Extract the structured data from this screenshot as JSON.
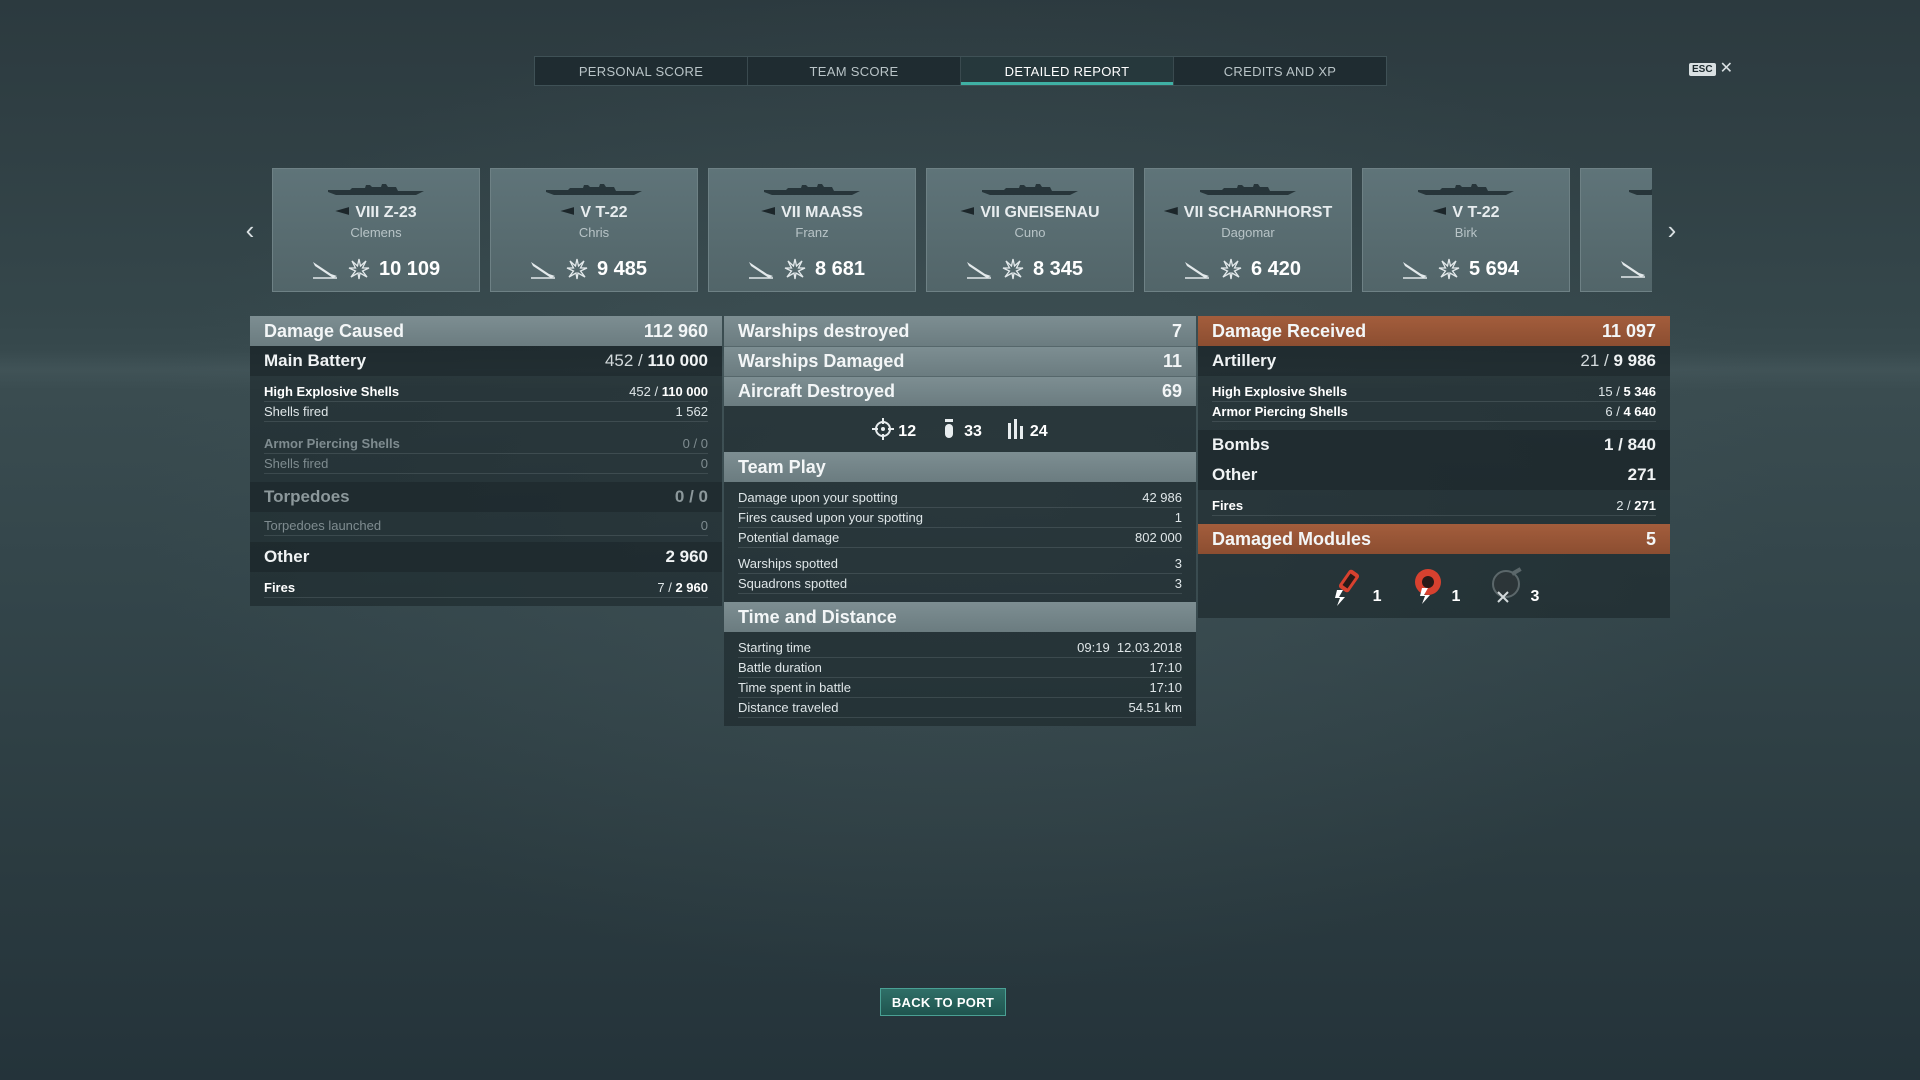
{
  "tabs": [
    {
      "label": "PERSONAL SCORE",
      "active": false
    },
    {
      "label": "TEAM SCORE",
      "active": false
    },
    {
      "label": "DETAILED REPORT",
      "active": true
    },
    {
      "label": "CREDITS AND XP",
      "active": false
    }
  ],
  "close": {
    "key": "ESC",
    "icon": "close-icon"
  },
  "ships": [
    {
      "tier": "VIII",
      "name": "Z-23",
      "player": "Clemens",
      "score": "10 109"
    },
    {
      "tier": "V",
      "name": "T-22",
      "player": "Chris",
      "score": "9 485"
    },
    {
      "tier": "VII",
      "name": "MAASS",
      "player": "Franz",
      "score": "8 681"
    },
    {
      "tier": "VII",
      "name": "GNEISENAU",
      "player": "Cuno",
      "score": "8 345"
    },
    {
      "tier": "VII",
      "name": "SCHARNHORST",
      "player": "Dagomar",
      "score": "6 420"
    },
    {
      "tier": "V",
      "name": "T-22",
      "player": "Birk",
      "score": "5 694"
    }
  ],
  "damage_caused": {
    "title": "Damage Caused",
    "value": "112 960",
    "main_battery": {
      "label": "Main Battery",
      "hit": "452 /",
      "total": "110 000"
    },
    "he": {
      "label": "High Explosive Shells",
      "hit": "452 /",
      "total": "110 000"
    },
    "he_fired": {
      "label": "Shells fired",
      "value": "1 562"
    },
    "ap": {
      "label": "Armor Piercing Shells",
      "hit": "0 /",
      "total": "0"
    },
    "ap_fired": {
      "label": "Shells fired",
      "value": "0"
    },
    "torpedoes": {
      "label": "Torpedoes",
      "value": "0 / 0"
    },
    "torpedoes_launched": {
      "label": "Torpedoes launched",
      "value": "0"
    },
    "other": {
      "label": "Other",
      "value": "2 960"
    },
    "fires": {
      "label": "Fires",
      "hit": "7 /",
      "total": "2 960"
    }
  },
  "center": {
    "warships_destroyed": {
      "label": "Warships destroyed",
      "value": "7"
    },
    "warships_damaged": {
      "label": "Warships Damaged",
      "value": "11"
    },
    "aircraft_destroyed": {
      "label": "Aircraft Destroyed",
      "value": "69"
    },
    "aircraft_icons": [
      {
        "icon": "crosshair-icon",
        "value": "12"
      },
      {
        "icon": "bomb-icon",
        "value": "33"
      },
      {
        "icon": "torpedo-bars-icon",
        "value": "24"
      }
    ],
    "team_play": {
      "title": "Team Play",
      "rows": [
        {
          "label": "Damage upon your spotting",
          "value": "42 986"
        },
        {
          "label": "Fires caused upon your spotting",
          "value": "1"
        },
        {
          "label": "Potential damage",
          "value": "802 000"
        },
        {
          "label": "Warships spotted",
          "value": "3"
        },
        {
          "label": "Squadrons spotted",
          "value": "3"
        }
      ]
    },
    "time_distance": {
      "title": "Time and Distance",
      "rows": [
        {
          "label": "Starting time",
          "value": "09:19  12.03.2018"
        },
        {
          "label": "Battle duration",
          "value": "17:10"
        },
        {
          "label": "Time spent in battle",
          "value": "17:10"
        },
        {
          "label": "Distance traveled",
          "value": "54.51 km"
        }
      ]
    }
  },
  "damage_received": {
    "title": "Damage Received",
    "value": "11 097",
    "artillery": {
      "label": "Artillery",
      "hit": "21 /",
      "total": "9 986"
    },
    "he": {
      "label": "High Explosive Shells",
      "hit": "15 /",
      "total": "5 346"
    },
    "ap": {
      "label": "Armor Piercing Shells",
      "hit": "6 /",
      "total": "4 640"
    },
    "bombs": {
      "label": "Bombs",
      "value": "1 / 840"
    },
    "other": {
      "label": "Other",
      "value": "271"
    },
    "fires": {
      "label": "Fires",
      "hit": "2 /",
      "total": "271"
    },
    "damaged_modules": {
      "label": "Damaged Modules",
      "value": "5"
    },
    "modules": [
      {
        "icon": "engine-damaged-icon",
        "value": "1"
      },
      {
        "icon": "steering-damaged-icon",
        "value": "1"
      },
      {
        "icon": "gun-destroyed-icon",
        "value": "3"
      }
    ]
  },
  "back_button": "BACK TO PORT",
  "colors": {
    "accent": "#3fb0a4",
    "orange_header": "#a35d3c",
    "grey_header": "#7d8e92",
    "module_red": "#d8412f"
  }
}
